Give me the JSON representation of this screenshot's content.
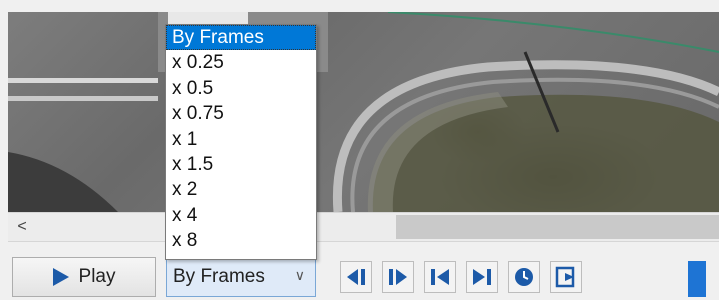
{
  "player": {
    "scroll_left_glyph": "<",
    "play_label": "Play",
    "speed_value": "By Frames",
    "speed_options": [
      "By Frames",
      "x 0.25",
      "x 0.5",
      "x 0.75",
      "x 1",
      "x 1.5",
      "x 2",
      "x 4",
      "x 8"
    ],
    "selected_option": 0
  },
  "icons": {
    "prev_frame": "step-back-icon",
    "next_frame": "step-forward-icon",
    "go_start": "skip-to-start-icon",
    "go_end": "skip-to-end-icon",
    "time": "clock-icon",
    "export": "export-icon"
  },
  "colors": {
    "accent": "#1c5aa8",
    "highlight": "#0078d7",
    "level": "#1e74d4"
  }
}
